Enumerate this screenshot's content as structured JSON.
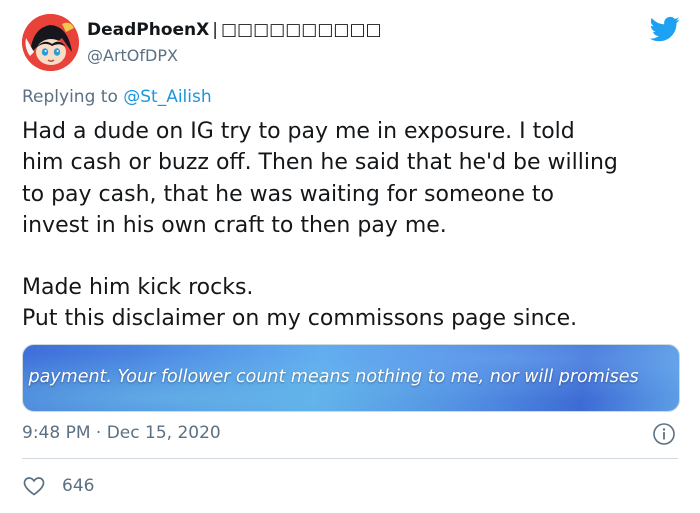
{
  "tweet": {
    "author": {
      "display_name": "DeadPhoenX",
      "separator": "|",
      "name_suffix": "□□□□□□□□□□",
      "handle": "@ArtOfDPX"
    },
    "reply_prefix": "Replying to",
    "reply_to": "@St_Ailish",
    "body_lines": [
      "Had a dude on IG try to pay me in exposure. I told",
      "him cash or buzz off. Then he said that he'd be willing",
      "to pay cash, that he was waiting for someone to",
      "invest in his own craft to then pay me."
    ],
    "body_lines_2": [
      "Made him kick rocks.",
      "Put this disclaimer on my commissons page since."
    ],
    "media_caption": ": payment. Your follower count means nothing to me, nor will promises",
    "timestamp": "9:48 PM · Dec 15, 2020",
    "like_count": "646",
    "colors": {
      "brand": "#1da1f2",
      "muted": "#5b7083",
      "mention": "#1b95e0"
    },
    "icons": [
      "twitter-bird-icon",
      "info-icon",
      "heart-icon"
    ]
  }
}
